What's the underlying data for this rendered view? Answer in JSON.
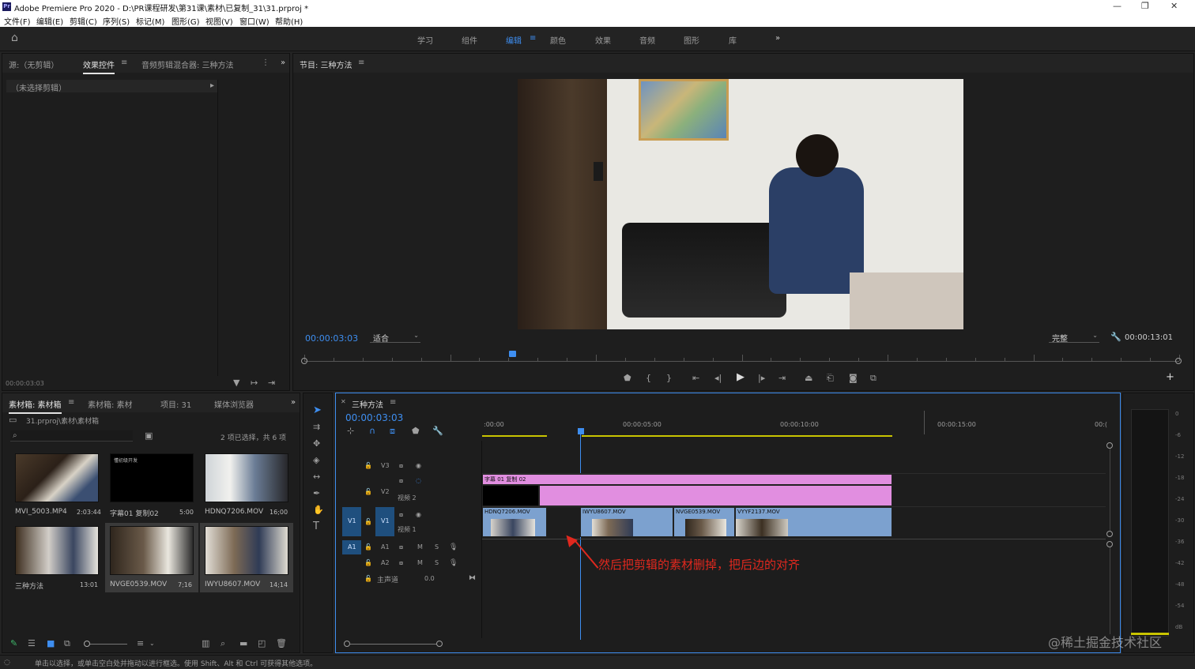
{
  "window": {
    "app_title": "Adobe Premiere Pro 2020 - D:\\PR课程研发\\第31课\\素材\\已复制_31\\31.prproj *"
  },
  "menu": [
    "文件(F)",
    "编辑(E)",
    "剪辑(C)",
    "序列(S)",
    "标记(M)",
    "图形(G)",
    "视图(V)",
    "窗口(W)",
    "帮助(H)"
  ],
  "workspaces": {
    "items": [
      "学习",
      "组件",
      "编辑",
      "颜色",
      "效果",
      "音频",
      "图形",
      "库"
    ],
    "active": "编辑"
  },
  "source_panel": {
    "tabs": [
      "源:（无剪辑）",
      "效果控件",
      "音频剪辑混合器: 三种方法"
    ],
    "active_tab": "效果控件",
    "no_clip": "（未选择剪辑）",
    "timecode": "00:00:03:03"
  },
  "program_monitor": {
    "title": "节目: 三种方法",
    "timecode": "00:00:03:03",
    "fit": "适合",
    "quality": "完整",
    "duration": "00:00:13:01",
    "playhead_fraction": 0.238
  },
  "project_panel": {
    "tabs": [
      "素材箱: 素材箱",
      "素材箱: 素材",
      "项目: 31",
      "媒体浏览器"
    ],
    "active_tab": "素材箱: 素材箱",
    "path": "31.prproj\\素材\\素材箱",
    "selection": "2 项已选择，共 6 项",
    "items": [
      {
        "name": "MVI_5003.MP4",
        "duration": "2:03:44",
        "thumb": "th1",
        "title_card": ""
      },
      {
        "name": "字幕01 复制02",
        "duration": "5:00",
        "thumb": "th2",
        "title_card": "懂初级开发"
      },
      {
        "name": "HDNQ7206.MOV",
        "duration": "16;00",
        "thumb": "th3",
        "title_card": ""
      },
      {
        "name": "三种方法",
        "duration": "13:01",
        "thumb": "th4",
        "title_card": ""
      },
      {
        "name": "NVGE0539.MOV",
        "duration": "7;16",
        "thumb": "th5",
        "title_card": ""
      },
      {
        "name": "IWYU8607.MOV",
        "duration": "14;14",
        "thumb": "th6",
        "title_card": ""
      }
    ]
  },
  "timeline": {
    "sequence": "三种方法",
    "timecode": "00:00:03:03",
    "ruler": [
      ":00:00",
      "00:00:05:00",
      "00:00:10:00",
      "00:00:15:00",
      "00:("
    ],
    "tracks": {
      "v3": "V3",
      "v2": "V2",
      "v2_name": "视频 2",
      "v1": "V1",
      "v1_name": "视频 1",
      "a1": "A1",
      "a2": "A2",
      "master": "主声道",
      "master_value": "0.0",
      "m": "M",
      "s": "S"
    },
    "clips": {
      "title_clip": "字幕 01 复制 02",
      "v1": [
        "HDNQ7206.MOV",
        "IWYU8607.MOV",
        "NVGE0539.MOV",
        "VYYF2137.MOV"
      ]
    },
    "annotation": "然后把剪辑的素材删掉，把后边的对齐"
  },
  "meter": {
    "scale": [
      "0",
      "-6",
      "-12",
      "-18",
      "-24",
      "-30",
      "-36",
      "-42",
      "-48",
      "-54",
      "dB"
    ]
  },
  "status_bar": {
    "text": "单击以选择，或单击空白处并拖动以进行框选。使用 Shift、Alt 和 Ctrl 可获得其他选项。"
  },
  "watermark": "@稀土掘金技术社区",
  "colors": {
    "accent_blue": "#3e8ef0",
    "video_clip": "#7ca1cf",
    "title_clip": "#e18ee0",
    "annotation_red": "#e0281e"
  }
}
